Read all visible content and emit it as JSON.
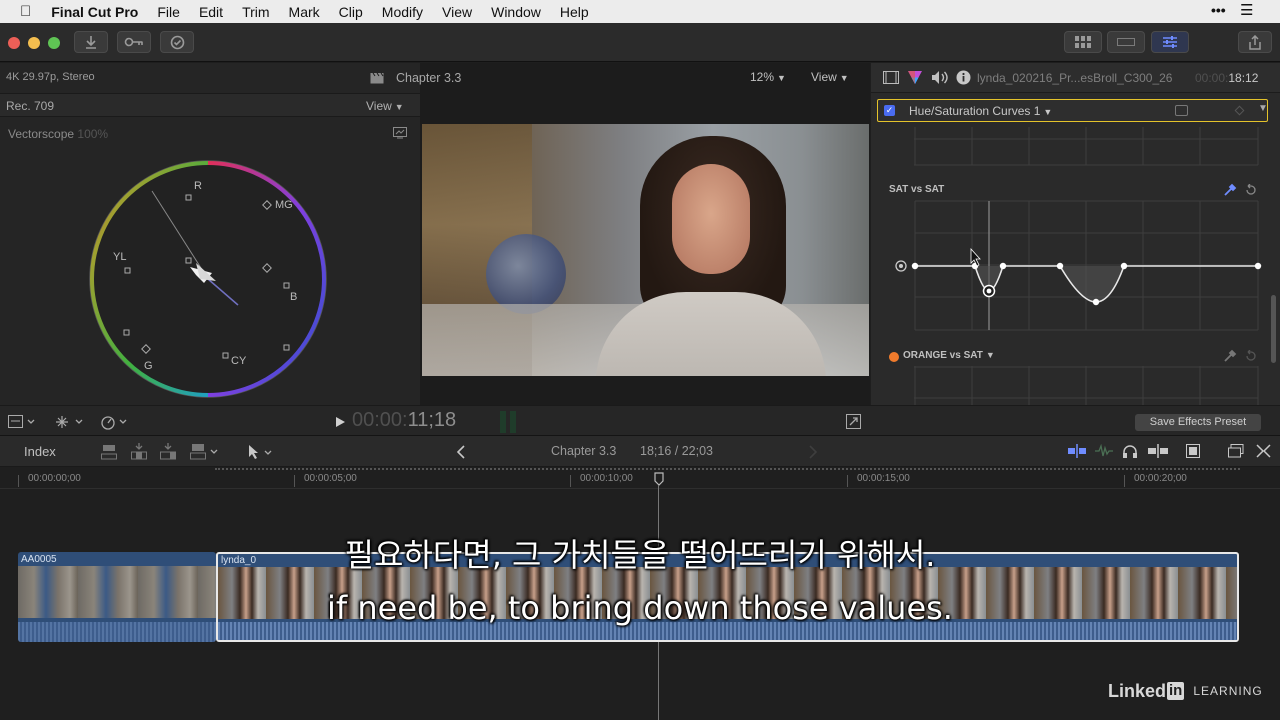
{
  "menubar": {
    "app_name": "Final Cut Pro",
    "items": [
      "File",
      "Edit",
      "Trim",
      "Mark",
      "Clip",
      "Modify",
      "View",
      "Window",
      "Help"
    ]
  },
  "toolbar": {
    "import_icon": "download-icon",
    "keyword_icon": "key-icon",
    "background_tasks_icon": "checkmark-circle-icon",
    "share_icon": "share-icon"
  },
  "scopes": {
    "format": "4K 29.97p, Stereo",
    "colorspace": "Rec. 709",
    "view_label": "View",
    "scope_name": "Vectorscope",
    "scope_percent": "100%",
    "targets": [
      "R",
      "MG",
      "YL",
      "B",
      "G",
      "CY"
    ]
  },
  "viewer": {
    "title": "Chapter 3.3",
    "zoom": "12%",
    "view_label": "View",
    "timecode_dim": "00:00:",
    "timecode": "11;18"
  },
  "inspector": {
    "clip_name": "lynda_020216_Pr...esBroll_C300_26",
    "duration_dim": "00:00:",
    "duration": "18:12",
    "effect_name": "Hue/Saturation Curves 1",
    "curve1_label": "SAT vs SAT",
    "curve2_label": "ORANGE vs SAT",
    "save_preset": "Save Effects Preset",
    "accent_color": "#e4c32b"
  },
  "timeline": {
    "index_label": "Index",
    "title": "Chapter 3.3",
    "position": "18;16 / 22;03",
    "ruler": [
      "00:00:00;00",
      "00:00:05;00",
      "00:00:10;00",
      "00:00:15;00",
      "00:00:20;00"
    ],
    "clip1_name": "AA0005",
    "clip2_name": "lynda_0"
  },
  "subtitles": {
    "korean": "필요하다면, 그 가치들을 떨어뜨리기 위해서.",
    "english": "if need be, to bring down those values."
  },
  "watermark": {
    "brand": "Linked",
    "brand_box": "in",
    "suffix": "LEARNING"
  }
}
